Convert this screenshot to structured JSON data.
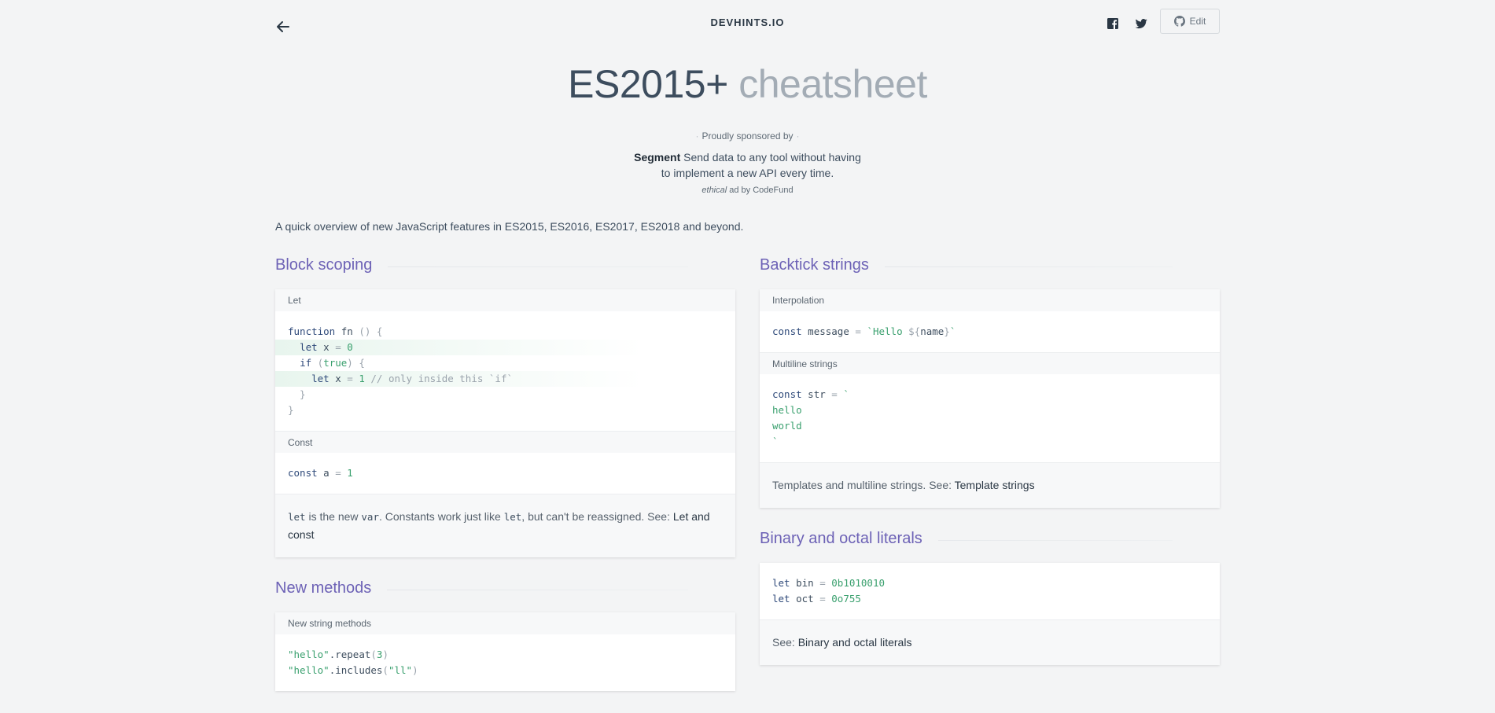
{
  "header": {
    "brand": "DEVHINTS.IO",
    "edit_label": "Edit"
  },
  "title": {
    "main": "ES2015+",
    "sub": "cheatsheet"
  },
  "sponsor": {
    "tag": "Proudly sponsored by",
    "company": "Segment",
    "text": "Send data to any tool without having to implement a new API every time.",
    "credit_ethical": "ethical",
    "credit_rest": "ad by CodeFund"
  },
  "intro": "A quick overview of new JavaScript features in ES2015, ES2016, ES2017, ES2018 and beyond.",
  "block_scoping": {
    "title": "Block scoping",
    "let_header": "Let",
    "const_header": "Const",
    "note_let": "let",
    "note_t1": " is the new ",
    "note_var": "var",
    "note_t2": ". Constants work just like ",
    "note_let2": "let",
    "note_t3": ", but can't be reassigned. See: ",
    "note_link": "Let and const"
  },
  "new_methods": {
    "title": "New methods",
    "header": "New string methods"
  },
  "backtick": {
    "title": "Backtick strings",
    "interp_header": "Interpolation",
    "multi_header": "Multiline strings",
    "note_text": "Templates and multiline strings. See: ",
    "note_link": "Template strings"
  },
  "binary": {
    "title": "Binary and octal literals",
    "note_text": "See: ",
    "note_link": "Binary and octal literals"
  }
}
